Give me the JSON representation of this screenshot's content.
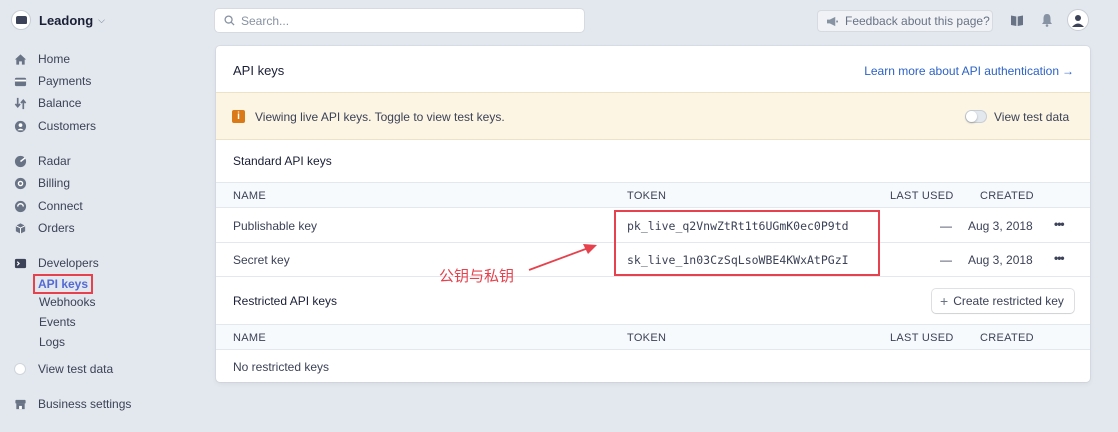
{
  "account": {
    "name": "Leadong"
  },
  "search": {
    "placeholder": "Search..."
  },
  "topbar": {
    "feedback_label": "Feedback about this page?"
  },
  "sidebar": {
    "items": [
      {
        "label": "Home",
        "icon": "home-icon"
      },
      {
        "label": "Payments",
        "icon": "payments-icon"
      },
      {
        "label": "Balance",
        "icon": "balance-icon"
      },
      {
        "label": "Customers",
        "icon": "customers-icon"
      },
      {
        "label": "Radar",
        "icon": "radar-icon"
      },
      {
        "label": "Billing",
        "icon": "billing-icon"
      },
      {
        "label": "Connect",
        "icon": "connect-icon"
      },
      {
        "label": "Orders",
        "icon": "orders-icon"
      },
      {
        "label": "Developers",
        "icon": "terminal-icon"
      }
    ],
    "developer_sub": [
      "API keys",
      "Webhooks",
      "Events",
      "Logs"
    ],
    "view_test_data": "View test data",
    "business_settings": "Business settings"
  },
  "card": {
    "title": "API keys",
    "learn_link": "Learn more about API authentication",
    "banner_message": "Viewing live API keys. Toggle to view test keys.",
    "banner_toggle_label": "View test data",
    "standard_title": "Standard API keys",
    "restricted_title": "Restricted API keys",
    "create_button": "Create restricted key",
    "columns": {
      "name": "NAME",
      "token": "TOKEN",
      "last_used": "LAST USED",
      "created": "CREATED"
    },
    "standard_rows": [
      {
        "name": "Publishable key",
        "token": "pk_live_q2VnwZtRt1t6UGmK0ec0P9td",
        "last_used": "—",
        "created": "Aug 3, 2018"
      },
      {
        "name": "Secret key",
        "token": "sk_live_1n03CzSqLsoWBE4KWxAtPGzI",
        "last_used": "—",
        "created": "Aug 3, 2018"
      }
    ],
    "restricted_empty": "No restricted keys"
  },
  "annotation": {
    "text": "公钥与私钥",
    "color": "#e5424d"
  },
  "colors": {
    "accent": "#5469d4",
    "link": "#2c62c5",
    "banner_bg": "#fcf5e3",
    "warning": "#d97917"
  }
}
